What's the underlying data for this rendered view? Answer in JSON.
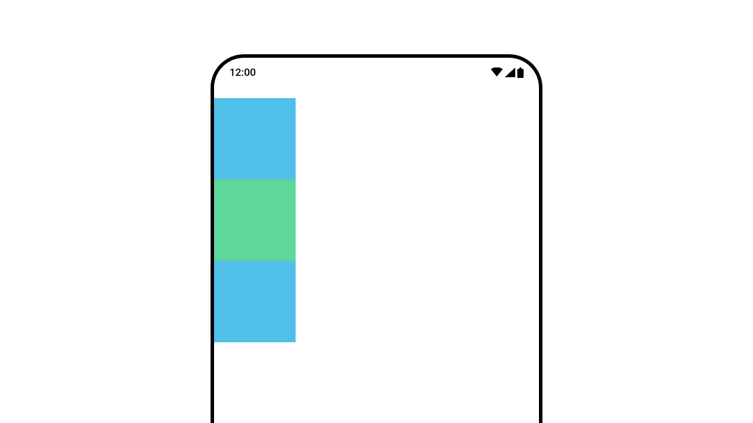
{
  "status_bar": {
    "time": "12:00",
    "icons": {
      "wifi": "wifi-icon",
      "cellular": "cellular-icon",
      "battery": "battery-icon"
    }
  },
  "blocks": [
    {
      "color": "#50C0E9"
    },
    {
      "color": "#5FD69A"
    },
    {
      "color": "#50C0E9"
    }
  ]
}
